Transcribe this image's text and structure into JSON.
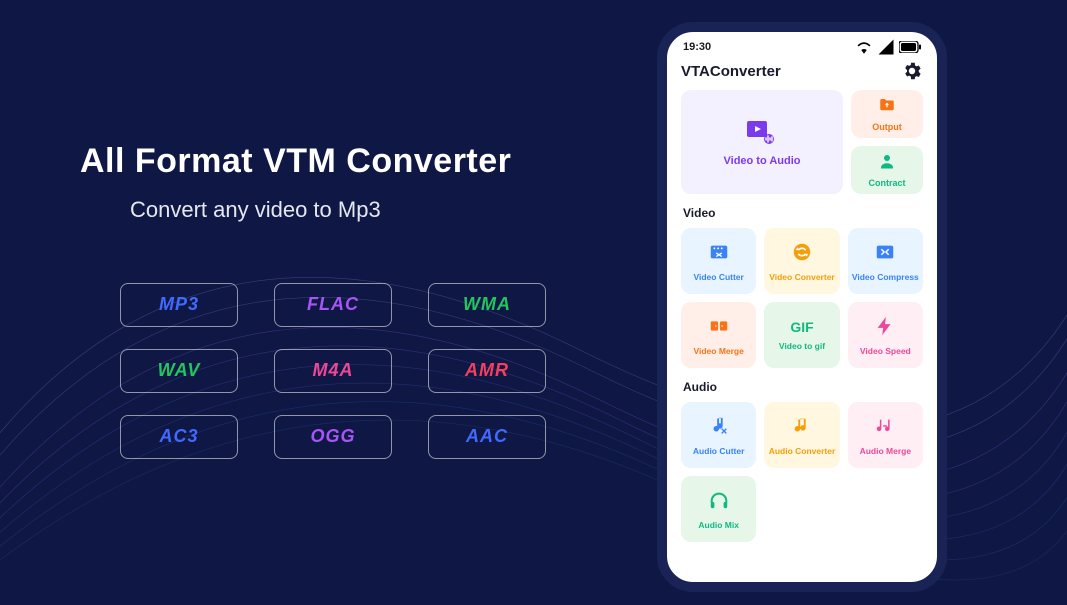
{
  "promo": {
    "title": "All Format VTM Converter",
    "subtitle": "Convert any video to Mp3",
    "formats": [
      {
        "label": "MP3",
        "color": "#4169ff"
      },
      {
        "label": "FLAC",
        "color": "#a855f7"
      },
      {
        "label": "WMA",
        "color": "#22c55e"
      },
      {
        "label": "WAV",
        "color": "#22c55e"
      },
      {
        "label": "M4A",
        "color": "#ec4899"
      },
      {
        "label": "AMR",
        "color": "#f43f5e"
      },
      {
        "label": "AC3",
        "color": "#4169ff"
      },
      {
        "label": "OGG",
        "color": "#a855f7"
      },
      {
        "label": "AAC",
        "color": "#4169ff"
      }
    ]
  },
  "phone": {
    "status_time": "19:30",
    "app_brand_bold": "VTA",
    "app_brand_rest": "Converter",
    "hero": {
      "label": "Video to Audio"
    },
    "side": [
      {
        "label": "Output",
        "bg": "bg-orange",
        "color": "c-orange",
        "icon": "folder"
      },
      {
        "label": "Contract",
        "bg": "bg-green",
        "color": "c-green",
        "icon": "person"
      }
    ],
    "sections": [
      {
        "title": "Video",
        "tiles": [
          {
            "label": "Video Cutter",
            "bg": "bg-blue",
            "color": "c-blue",
            "icon": "cut"
          },
          {
            "label": "Video Converter",
            "bg": "bg-yellow",
            "color": "c-yellow",
            "icon": "convert"
          },
          {
            "label": "Video Compress",
            "bg": "bg-blue",
            "color": "c-blue",
            "icon": "compress"
          },
          {
            "label": "Video Merge",
            "bg": "bg-orange",
            "color": "c-orange",
            "icon": "merge"
          },
          {
            "label": "Video to gif",
            "bg": "bg-green",
            "color": "c-green",
            "icon": "gif"
          },
          {
            "label": "Video Speed",
            "bg": "bg-pink",
            "color": "c-pink",
            "icon": "speed"
          }
        ]
      },
      {
        "title": "Audio",
        "tiles": [
          {
            "label": "Audio Cutter",
            "bg": "bg-blue",
            "color": "c-blue",
            "icon": "audiocut"
          },
          {
            "label": "Audio Converter",
            "bg": "bg-yellow",
            "color": "c-yellow",
            "icon": "audioconv"
          },
          {
            "label": "Audio Merge",
            "bg": "bg-pink",
            "color": "c-pink",
            "icon": "audiomerge"
          },
          {
            "label": "Audio Mix",
            "bg": "bg-green",
            "color": "c-green",
            "icon": "headphone"
          }
        ]
      }
    ]
  }
}
